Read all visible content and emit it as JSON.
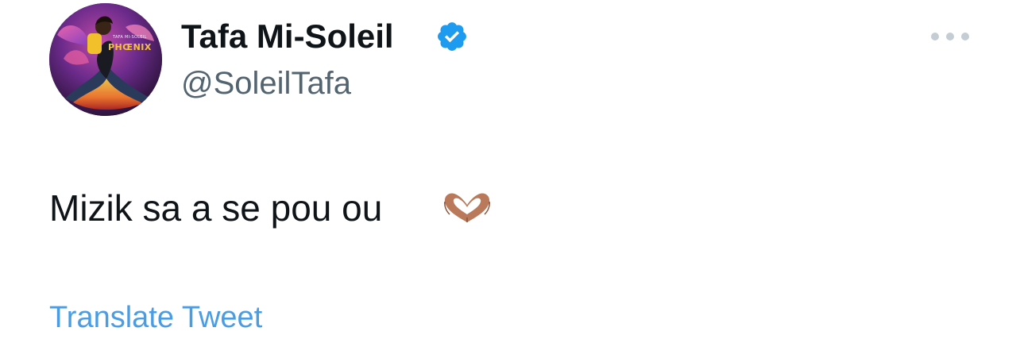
{
  "author": {
    "display_name": "Tafa Mi-Soleil",
    "handle": "@SoleilTafa",
    "verified": true,
    "avatar": {
      "artist_text": "TAFA MI-SOLEIL",
      "album_text": "PHŒNIX"
    }
  },
  "tweet": {
    "text": "Mizik sa a se pou ou",
    "emoji": "heart-hands-emoji"
  },
  "actions": {
    "translate_label": "Translate Tweet",
    "more_icon": "more-horizontal-icon"
  },
  "colors": {
    "verified_blue": "#1d9bf0",
    "link_blue": "#4a9de3",
    "handle_gray": "#536471",
    "text": "#0f1419",
    "dots": "#c4cdd4"
  }
}
